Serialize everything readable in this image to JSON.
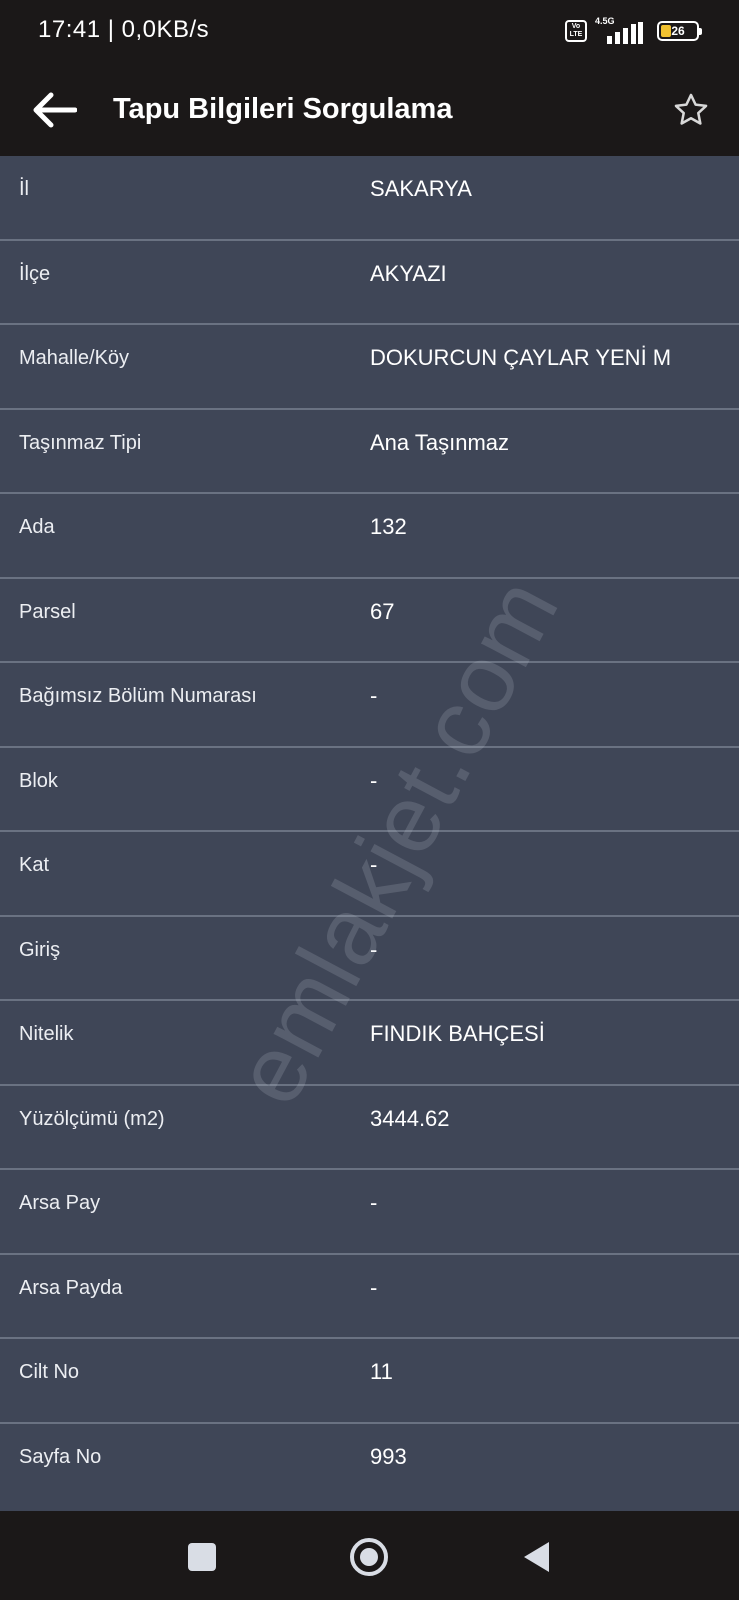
{
  "status_bar": {
    "time_speed": "17:41 | 0,0KB/s",
    "volte_label": "Vo LTE",
    "network_type": "4.5G",
    "battery_level": "26"
  },
  "app_bar": {
    "title": "Tapu Bilgileri Sorgulama",
    "back_icon": "arrow-left-icon",
    "favorite_icon": "star-outline-icon"
  },
  "rows": [
    {
      "label": "İl",
      "value": "SAKARYA"
    },
    {
      "label": "İlçe",
      "value": "AKYAZI"
    },
    {
      "label": "Mahalle/Köy",
      "value": "DOKURCUN ÇAYLAR YENİ M"
    },
    {
      "label": "Taşınmaz Tipi",
      "value": "Ana Taşınmaz"
    },
    {
      "label": "Ada",
      "value": "132"
    },
    {
      "label": "Parsel",
      "value": "67"
    },
    {
      "label": "Bağımsız Bölüm Numarası",
      "value": "-"
    },
    {
      "label": "Blok",
      "value": "-"
    },
    {
      "label": "Kat",
      "value": "-"
    },
    {
      "label": "Giriş",
      "value": "-"
    },
    {
      "label": "Nitelik",
      "value": "FINDIK BAHÇESİ"
    },
    {
      "label": "Yüzölçümü (m2)",
      "value": "3444.62"
    },
    {
      "label": "Arsa Pay",
      "value": "-"
    },
    {
      "label": "Arsa Payda",
      "value": "-"
    },
    {
      "label": "Cilt No",
      "value": "11"
    },
    {
      "label": "Sayfa No",
      "value": "993"
    }
  ],
  "watermark": "emlakjet.com",
  "nav_bar": {
    "recent_icon": "square-icon",
    "home_icon": "circle-home-icon",
    "back_icon": "triangle-back-icon"
  },
  "colors": {
    "bar_background": "#1b1818",
    "content_background": "#3f4657",
    "divider": "#6a7282",
    "text": "#ffffff"
  }
}
